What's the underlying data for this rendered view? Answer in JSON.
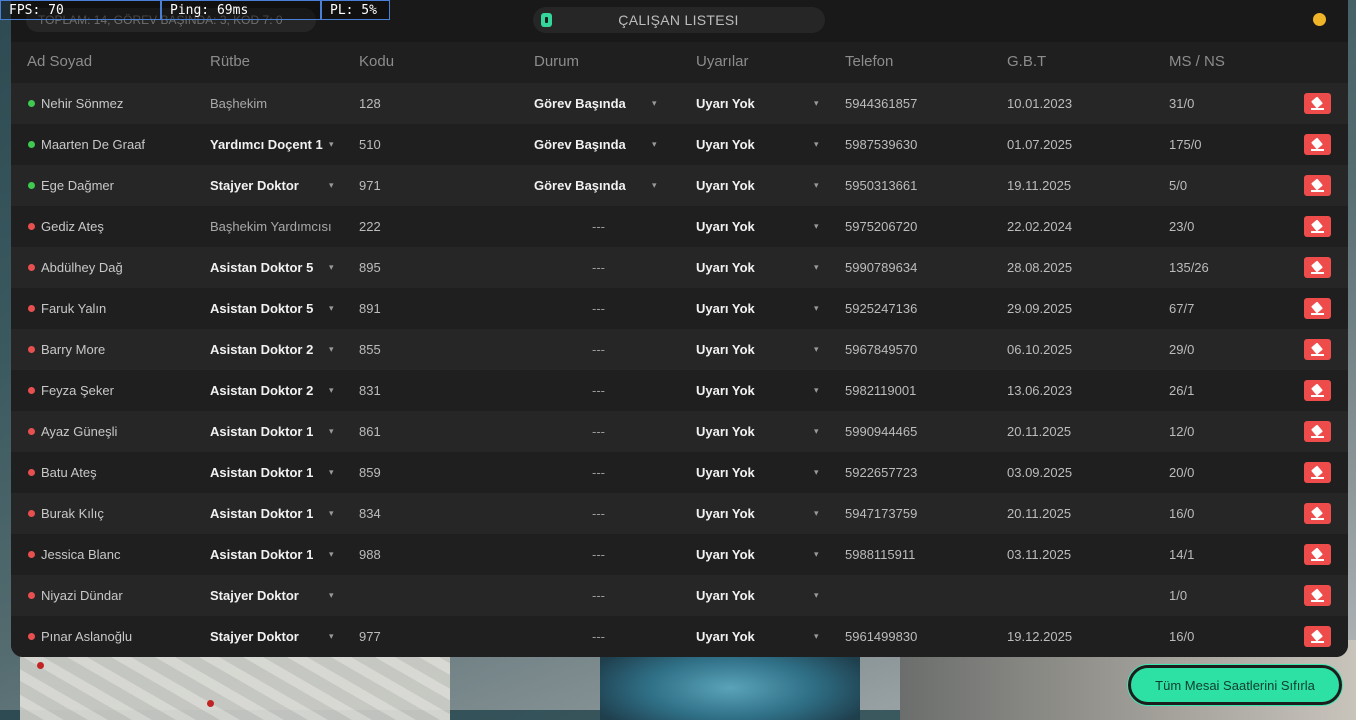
{
  "debug": {
    "fps": "FPS: 70",
    "ping": "Ping: 69ms",
    "pl": "PL: 5%"
  },
  "summary": "TOPLAM: 14, GÖREV BAŞINDA: 3, KOD 7: 0",
  "title": "ÇALIŞAN LISTESI",
  "colors": {
    "online": "#3ec94f",
    "offline": "#e85050",
    "status_dot": "#f0b429",
    "accent": "#2de0a4",
    "delete": "#ee4b4b"
  },
  "columns": [
    "Ad Soyad",
    "Rütbe",
    "Kodu",
    "Durum",
    "Uyarılar",
    "Telefon",
    "G.B.T",
    "MS / NS"
  ],
  "rows": [
    {
      "name": "Nehir Sönmez",
      "online": true,
      "rank": "Başhekim",
      "rank_editable": false,
      "code": "128",
      "duty": "Görev Başında",
      "warn": "Uyarı Yok",
      "phone": "5944361857",
      "gbt": "10.01.2023",
      "ms": "31/0"
    },
    {
      "name": "Maarten De Graaf",
      "online": true,
      "rank": "Yardımcı Doçent 1",
      "rank_editable": true,
      "code": "510",
      "duty": "Görev Başında",
      "warn": "Uyarı Yok",
      "phone": "5987539630",
      "gbt": "01.07.2025",
      "ms": "175/0"
    },
    {
      "name": "Ege Dağmer",
      "online": true,
      "rank": "Stajyer Doktor",
      "rank_editable": true,
      "code": "971",
      "duty": "Görev Başında",
      "warn": "Uyarı Yok",
      "phone": "5950313661",
      "gbt": "19.11.2025",
      "ms": "5/0"
    },
    {
      "name": "Gediz Ateş",
      "online": false,
      "rank": "Başhekim Yardımcısı",
      "rank_editable": false,
      "code": "222",
      "duty": "---",
      "warn": "Uyarı Yok",
      "phone": "5975206720",
      "gbt": "22.02.2024",
      "ms": "23/0"
    },
    {
      "name": "Abdülhey Dağ",
      "online": false,
      "rank": "Asistan Doktor 5",
      "rank_editable": true,
      "code": "895",
      "duty": "---",
      "warn": "Uyarı Yok",
      "phone": "5990789634",
      "gbt": "28.08.2025",
      "ms": "135/26"
    },
    {
      "name": "Faruk Yalın",
      "online": false,
      "rank": "Asistan Doktor 5",
      "rank_editable": true,
      "code": "891",
      "duty": "---",
      "warn": "Uyarı Yok",
      "phone": "5925247136",
      "gbt": "29.09.2025",
      "ms": "67/7"
    },
    {
      "name": "Barry More",
      "online": false,
      "rank": "Asistan Doktor 2",
      "rank_editable": true,
      "code": "855",
      "duty": "---",
      "warn": "Uyarı Yok",
      "phone": "5967849570",
      "gbt": "06.10.2025",
      "ms": "29/0"
    },
    {
      "name": "Feyza Şeker",
      "online": false,
      "rank": "Asistan Doktor 2",
      "rank_editable": true,
      "code": "831",
      "duty": "---",
      "warn": "Uyarı Yok",
      "phone": "5982119001",
      "gbt": "13.06.2023",
      "ms": "26/1"
    },
    {
      "name": "Ayaz Güneşli",
      "online": false,
      "rank": "Asistan Doktor 1",
      "rank_editable": true,
      "code": "861",
      "duty": "---",
      "warn": "Uyarı Yok",
      "phone": "5990944465",
      "gbt": "20.11.2025",
      "ms": "12/0"
    },
    {
      "name": "Batu Ateş",
      "online": false,
      "rank": "Asistan Doktor 1",
      "rank_editable": true,
      "code": "859",
      "duty": "---",
      "warn": "Uyarı Yok",
      "phone": "5922657723",
      "gbt": "03.09.2025",
      "ms": "20/0"
    },
    {
      "name": "Burak Kılıç",
      "online": false,
      "rank": "Asistan Doktor 1",
      "rank_editable": true,
      "code": "834",
      "duty": "---",
      "warn": "Uyarı Yok",
      "phone": "5947173759",
      "gbt": "20.11.2025",
      "ms": "16/0"
    },
    {
      "name": "Jessica Blanc",
      "online": false,
      "rank": "Asistan Doktor 1",
      "rank_editable": true,
      "code": "988",
      "duty": "---",
      "warn": "Uyarı Yok",
      "phone": "5988115911",
      "gbt": "03.11.2025",
      "ms": "14/1"
    },
    {
      "name": "Niyazi Dündar",
      "online": false,
      "rank": "Stajyer Doktor",
      "rank_editable": true,
      "code": "",
      "duty": "---",
      "warn": "Uyarı Yok",
      "phone": "",
      "gbt": "",
      "ms": "1/0"
    },
    {
      "name": "Pınar Aslanoğlu",
      "online": false,
      "rank": "Stajyer Doktor",
      "rank_editable": true,
      "code": "977",
      "duty": "---",
      "warn": "Uyarı Yok",
      "phone": "5961499830",
      "gbt": "19.12.2025",
      "ms": "16/0"
    }
  ],
  "icons": {
    "dropdown": "chevron-down-icon",
    "delete": "eraser-icon",
    "title": "badge-icon"
  },
  "reset_button": "Tüm Mesai Saatlerini Sıfırla"
}
